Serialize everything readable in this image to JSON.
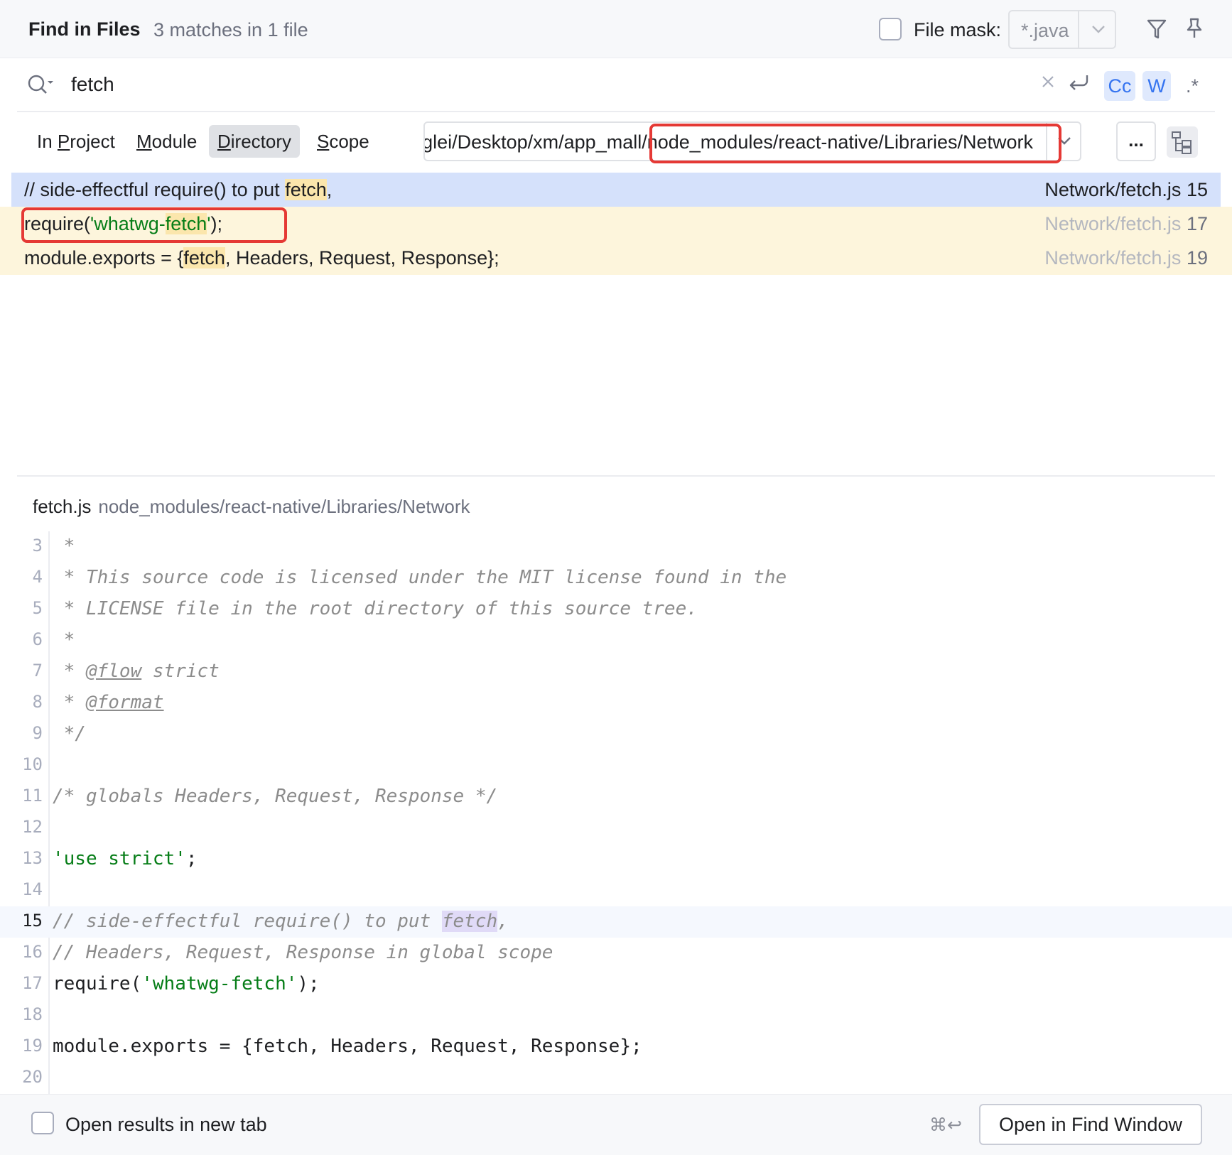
{
  "header": {
    "title": "Find in Files",
    "match_summary": "3 matches in 1 file",
    "file_mask_label": "File mask:",
    "file_mask_value": "*.java",
    "file_mask_checked": false
  },
  "search": {
    "query": "fetch",
    "options": {
      "match_case": "Cc",
      "words": "W",
      "regex": ".*"
    }
  },
  "scope": {
    "tabs": [
      {
        "pre": "In ",
        "u": "P",
        "post": "roject"
      },
      {
        "pre": "",
        "u": "M",
        "post": "odule"
      },
      {
        "pre": "",
        "u": "D",
        "post": "irectory"
      },
      {
        "pre": "",
        "u": "S",
        "post": "cope"
      }
    ],
    "selected": "Directory",
    "directory": "gleiDesktop/xm/app_mall/node_modules/react-native/Libraries/Network",
    "directory_visible": "glei/Desktop/xm/app_mall/node_modules/react-native/Libraries/Network",
    "browse_label": "..."
  },
  "results": [
    {
      "pre": "// side-effectful require() to put ",
      "match": "fetch",
      "post": ",",
      "file": "Network/fetch.js",
      "line": "15"
    },
    {
      "pre": "require(",
      "str_pre": "'whatwg-",
      "match": "fetch",
      "str_post": "'",
      "post": ");",
      "file": "Network/fetch.js",
      "line": "17"
    },
    {
      "pre": "module.exports = {",
      "match": "fetch",
      "post": ", Headers, Request, Response};",
      "file": "Network/fetch.js",
      "line": "19"
    }
  ],
  "preview": {
    "file_name": "fetch.js",
    "file_path": "node_modules/react-native/Libraries/Network",
    "lines": [
      {
        "n": "3",
        "text": " *"
      },
      {
        "n": "4",
        "text": " * This source code is licensed under the MIT license found in the"
      },
      {
        "n": "5",
        "text": " * LICENSE file in the root directory of this source tree."
      },
      {
        "n": "6",
        "text": " *"
      },
      {
        "n": "7",
        "text": " * ",
        "tag": "@flow",
        "rest": " strict"
      },
      {
        "n": "8",
        "text": " * ",
        "tag": "@format",
        "rest": ""
      },
      {
        "n": "9",
        "text": " */"
      },
      {
        "n": "10",
        "text": ""
      },
      {
        "n": "11",
        "text": "/* globals Headers, Request, Response */"
      },
      {
        "n": "12",
        "text": ""
      },
      {
        "n": "13",
        "text": "'use strict'",
        "after": ";"
      },
      {
        "n": "14",
        "text": ""
      },
      {
        "n": "15",
        "text": "// side-effectful require() to put ",
        "match": "fetch",
        "after_cmt": ","
      },
      {
        "n": "16",
        "text": "// Headers, Request, Response in global scope"
      },
      {
        "n": "17",
        "text": "require(",
        "str": "'whatwg-fetch'",
        "after": ");"
      },
      {
        "n": "18",
        "text": ""
      },
      {
        "n": "19",
        "text": "module.exports = {fetch, Headers, Request, Response};"
      },
      {
        "n": "20",
        "text": ""
      }
    ]
  },
  "footer": {
    "new_tab_label": "Open results in new tab",
    "new_tab_checked": false,
    "shortcut": "⌘↩",
    "open_button": "Open in Find Window"
  },
  "colors": {
    "selection": "#d5e1fb",
    "result_row": "#fdf5dc",
    "match_highlight": "#fbe6ac",
    "annotation_box": "#e53935",
    "string": "#067d17",
    "comment": "#8c8c8c"
  }
}
